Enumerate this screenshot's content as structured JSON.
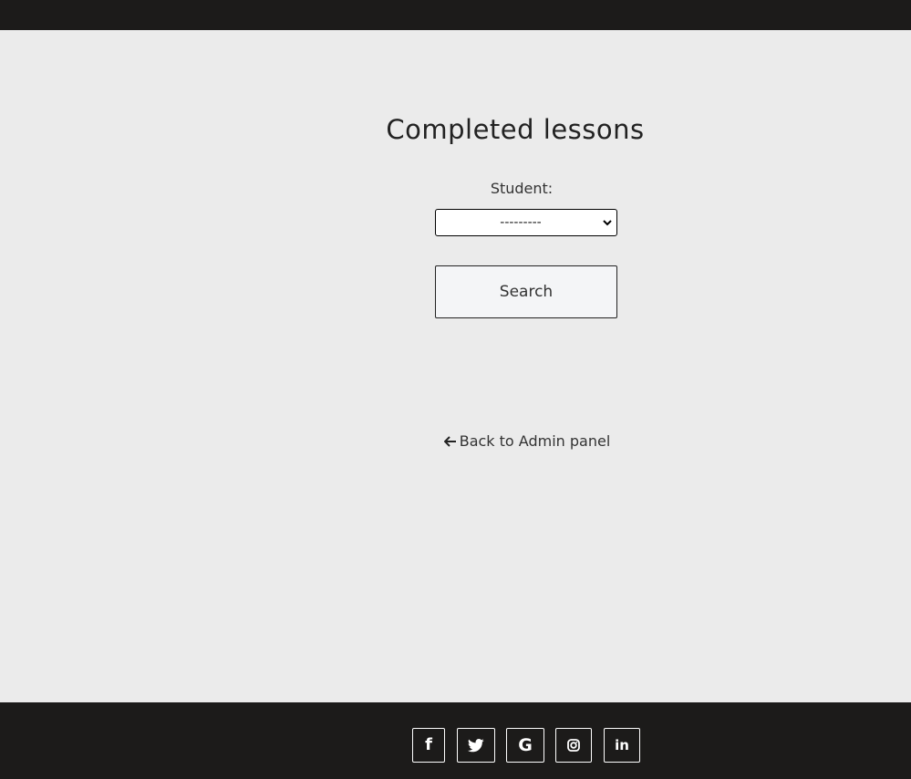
{
  "page": {
    "title": "Completed lessons"
  },
  "form": {
    "student_label": "Student:",
    "student_select_value": "---------",
    "search_label": "Search"
  },
  "nav": {
    "back_label": "Back to Admin panel"
  },
  "footer": {
    "social": [
      {
        "name": "facebook",
        "glyph": "f"
      },
      {
        "name": "twitter",
        "glyph": ""
      },
      {
        "name": "google",
        "glyph": "G"
      },
      {
        "name": "instagram",
        "glyph": ""
      },
      {
        "name": "linkedin",
        "glyph": "in"
      }
    ]
  },
  "colors": {
    "header_bg": "#1c1b1a",
    "page_bg": "#ebebeb",
    "footer_bg": "#1c1b1a",
    "text": "#222222",
    "button_bg": "#f4f5f7"
  },
  "icons": {
    "back": "arrow-left-icon",
    "select": "chevron-down-icon",
    "social": [
      "facebook-icon",
      "twitter-icon",
      "google-icon",
      "instagram-icon",
      "linkedin-icon"
    ]
  }
}
